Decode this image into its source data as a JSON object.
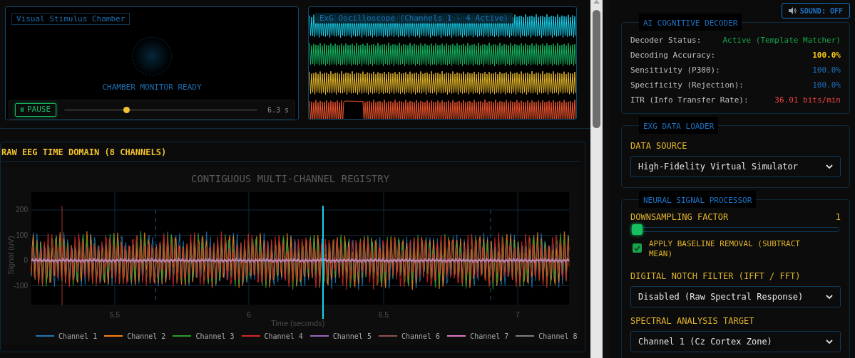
{
  "chamber": {
    "title": "Visual Stimulus Chamber",
    "status": "CHAMBER MONITOR READY",
    "pause_button": "PAUSE",
    "playback": {
      "level": 0.32,
      "reading": "6.3 s"
    }
  },
  "oscilloscope": {
    "title": "ExG Oscilloscope (Channels 1 - 4 Active)",
    "channels": [
      {
        "color": "#19d3f0"
      },
      {
        "color": "#16b864"
      },
      {
        "color": "#e8b92c"
      },
      {
        "color": "#f0562e"
      }
    ]
  },
  "eeg_panel": {
    "heading": "RAW EEG TIME DOMAIN (8 CHANNELS)",
    "chart_title": "CONTIGUOUS MULTI-CHANNEL REGISTRY",
    "ylabel": "Signal (uV)",
    "xlabel": "Time (seconds)",
    "yticks": [
      "200",
      "100",
      "0",
      "-100"
    ],
    "xticks": [
      "5.5",
      "6",
      "6.5",
      "7"
    ],
    "legend": [
      {
        "name": "Channel 1",
        "color": "#1f77b4"
      },
      {
        "name": "Channel 2",
        "color": "#ff7f0e"
      },
      {
        "name": "Channel 3",
        "color": "#2ca02c"
      },
      {
        "name": "Channel 4",
        "color": "#d62728"
      },
      {
        "name": "Channel 5",
        "color": "#9467bd"
      },
      {
        "name": "Channel 6",
        "color": "#8c564b"
      },
      {
        "name": "Channel 7",
        "color": "#e377c2"
      },
      {
        "name": "Channel 8",
        "color": "#7f7f7f"
      }
    ]
  },
  "sound_button": {
    "label": "SOUND: OFF"
  },
  "decoder": {
    "title": "AI COGNITIVE DECODER",
    "rows": [
      {
        "label": "Decoder Status:",
        "value": "Active (Template Matcher)",
        "color": "#16a34a"
      },
      {
        "label": "Decoding Accuracy:",
        "value": "100.0%",
        "color": "#facc15"
      },
      {
        "label": "Sensitivity (P300):",
        "value": "100.0%",
        "color": "#1d72c2"
      },
      {
        "label": "Specificity (Rejection):",
        "value": "100.0%",
        "color": "#1d72c2"
      },
      {
        "label": "ITR (Info Transfer Rate):",
        "value": "36.01 bits/min",
        "color": "#ef4444"
      }
    ]
  },
  "data_loader": {
    "title": "EXG DATA LOADER",
    "source_label": "DATA SOURCE",
    "source_value": "High-Fidelity Virtual Simulator"
  },
  "processor": {
    "title": "NEURAL SIGNAL PROCESSOR",
    "downsampling": {
      "label": "DOWNSAMPLING FACTOR",
      "reading": "1",
      "level": 0
    },
    "baseline": {
      "label": "APPLY BASELINE REMOVAL (SUBTRACT MEAN)",
      "checked": true
    },
    "notch_label": "DIGITAL NOTCH FILTER (IFFT / FFT)",
    "notch_value": "Disabled (Raw Spectral Response)",
    "target_label": "SPECTRAL ANALYSIS TARGET",
    "target_value": "Channel 1 (Cz Cortex Zone)"
  }
}
